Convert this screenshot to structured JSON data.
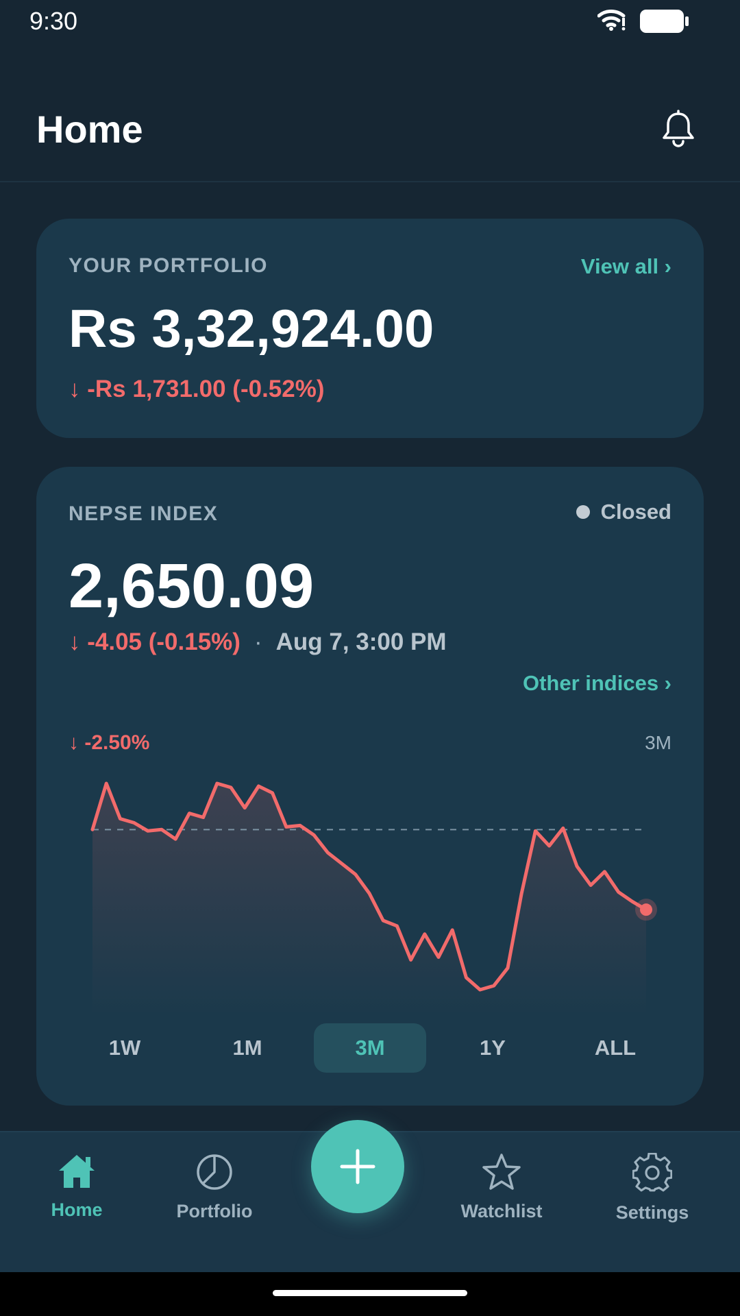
{
  "status_bar": {
    "time": "9:30"
  },
  "header": {
    "title": "Home"
  },
  "portfolio": {
    "label": "YOUR PORTFOLIO",
    "view_all": "View all ›",
    "value": "Rs 3,32,924.00",
    "change": "↓ -Rs 1,731.00 (-0.52%)"
  },
  "nepse": {
    "label": "NEPSE INDEX",
    "market_status": "Closed",
    "value": "2,650.09",
    "change": "↓ -4.05 (-0.15%)",
    "separator": "·",
    "timestamp": "Aug 7, 3:00 PM",
    "other_indices": "Other indices ›"
  },
  "chart_data": {
    "type": "area",
    "period_change": "↓ -2.50%",
    "period_label": "3M",
    "line_color": "#f26b6b",
    "baseline_shown": true,
    "values": [
      2718,
      2752,
      2726,
      2723,
      2717,
      2718,
      2711,
      2730,
      2727,
      2752,
      2749,
      2734,
      2750,
      2745,
      2720,
      2721,
      2714,
      2701,
      2693,
      2685,
      2671,
      2651,
      2647,
      2622,
      2641,
      2624,
      2644,
      2609,
      2600,
      2603,
      2616,
      2671,
      2717,
      2706,
      2719,
      2691,
      2677,
      2687,
      2672,
      2665,
      2659
    ]
  },
  "range_tabs": [
    {
      "label": "1W",
      "active": false
    },
    {
      "label": "1M",
      "active": false
    },
    {
      "label": "3M",
      "active": true
    },
    {
      "label": "1Y",
      "active": false
    },
    {
      "label": "ALL",
      "active": false
    }
  ],
  "bottom_nav": {
    "items": [
      {
        "label": "Home",
        "icon": "home-icon",
        "active": true
      },
      {
        "label": "Portfolio",
        "icon": "pie-chart-icon",
        "active": false
      },
      {
        "label": "Watchlist",
        "icon": "star-icon",
        "active": false
      },
      {
        "label": "Settings",
        "icon": "gear-icon",
        "active": false
      }
    ],
    "fab_icon": "plus-icon"
  },
  "colors": {
    "accent": "#4fc3b6",
    "negative": "#f26b6b",
    "background": "#162633",
    "card": "#1b394b"
  }
}
